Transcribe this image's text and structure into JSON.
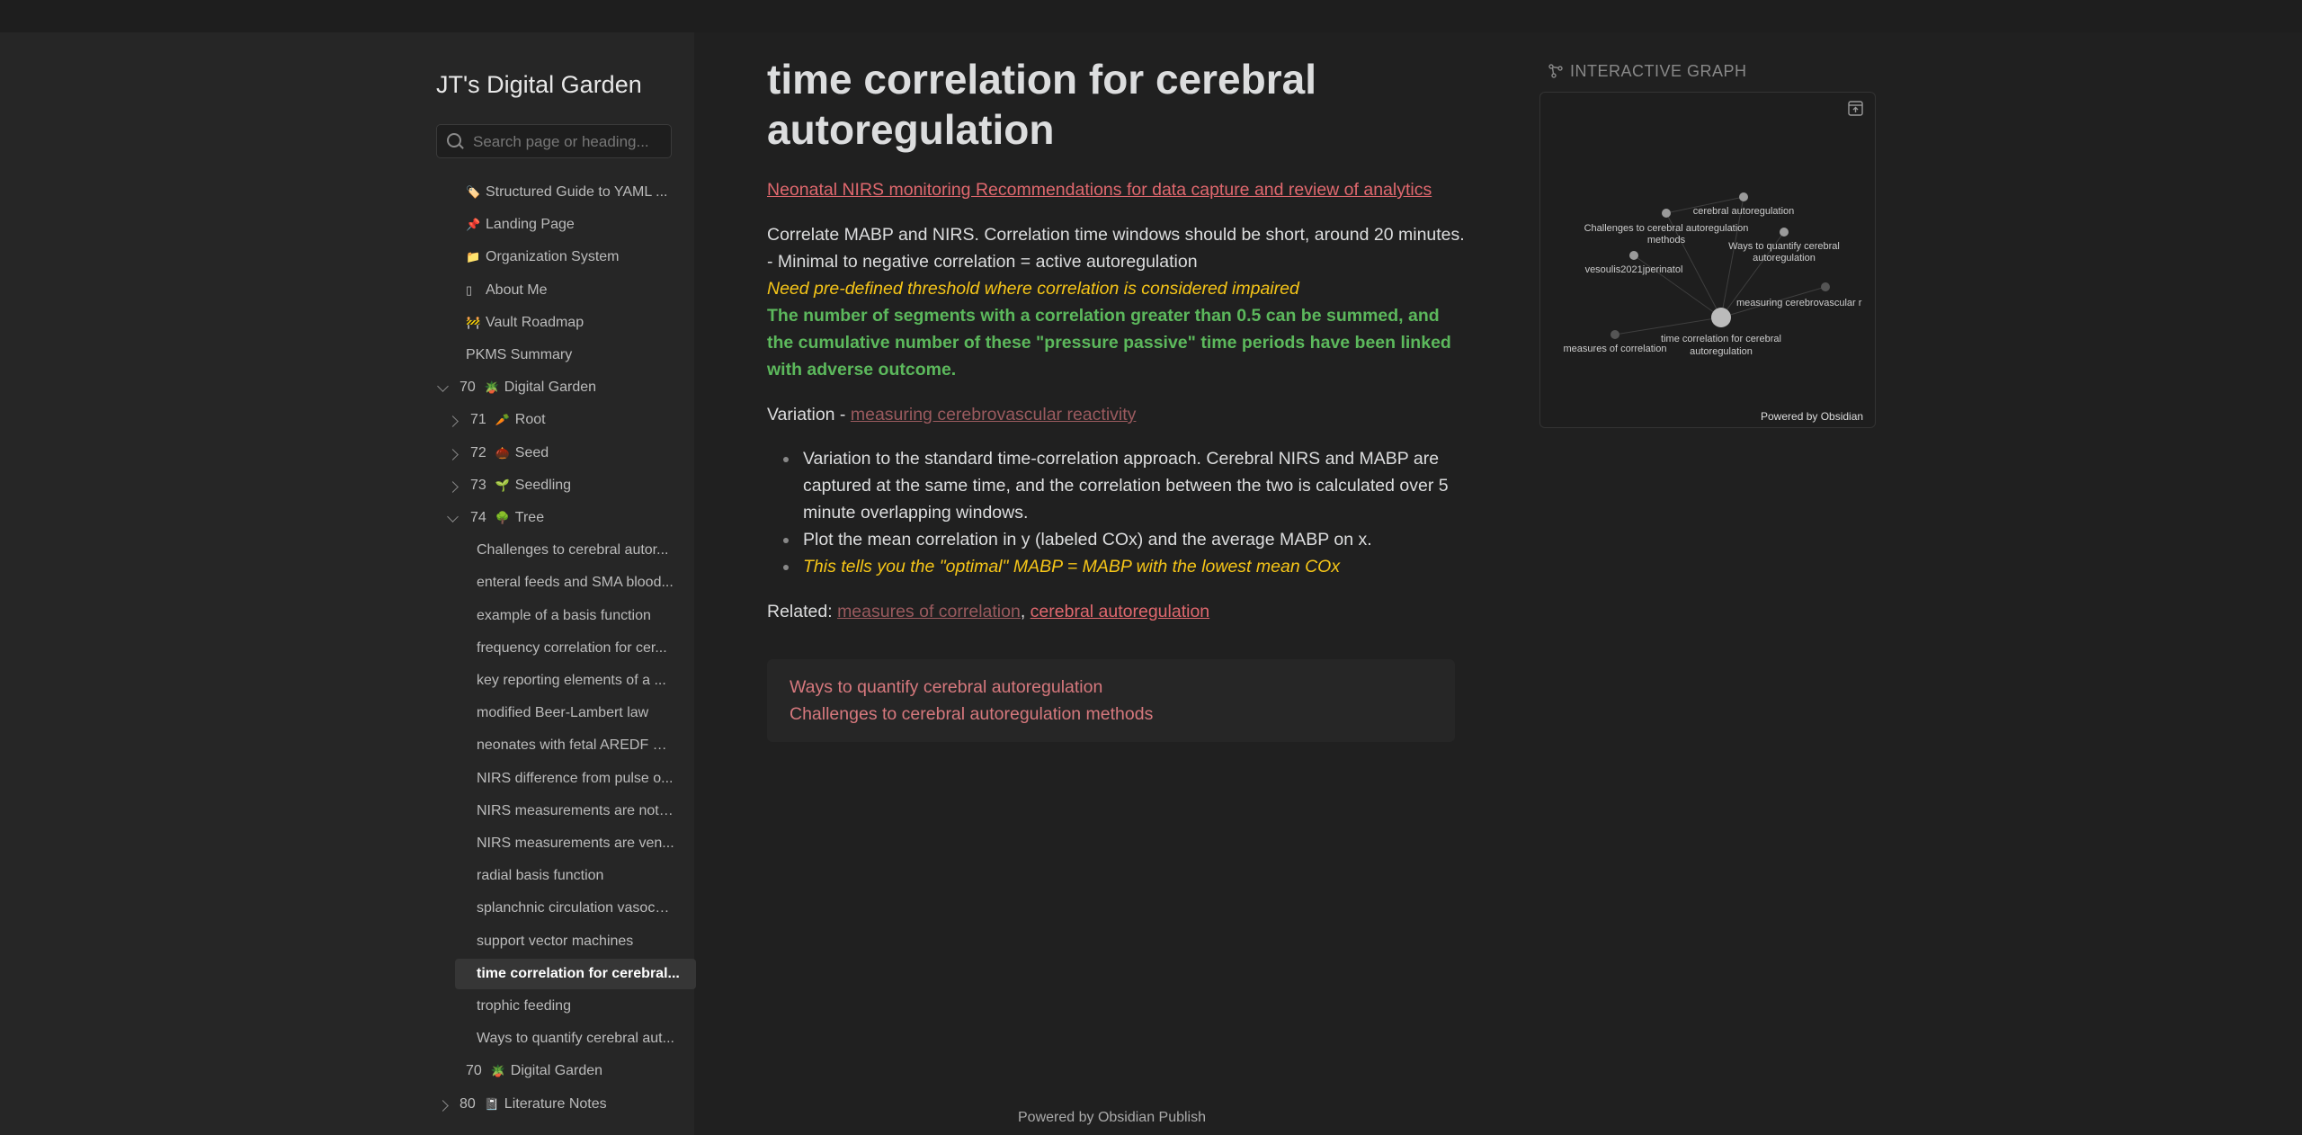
{
  "site": {
    "title": "JT's Digital Garden",
    "search_placeholder": "Search page or heading..."
  },
  "sidebar": {
    "top_items": [
      {
        "icon": "🏷️",
        "label": "Structured Guide to YAML ..."
      },
      {
        "icon": "📌",
        "label": "Landing Page"
      },
      {
        "icon": "📁",
        "label": "Organization System"
      },
      {
        "icon": "▯",
        "label": "About Me"
      },
      {
        "icon": "🚧",
        "label": "Vault Roadmap"
      },
      {
        "icon": "",
        "label": "PKMS Summary"
      }
    ],
    "digital_garden": {
      "num": "70",
      "icon": "🪴",
      "label": "Digital Garden"
    },
    "folders": [
      {
        "num": "71",
        "icon": "🥕",
        "label": "Root"
      },
      {
        "num": "72",
        "icon": "🌰",
        "label": "Seed"
      },
      {
        "num": "73",
        "icon": "🌱",
        "label": "Seedling"
      },
      {
        "num": "74",
        "icon": "🌳",
        "label": "Tree"
      }
    ],
    "tree_items": [
      "Challenges to cerebral autor...",
      "enteral feeds and SMA blood...",
      "example of a basis function",
      "frequency correlation for cer...",
      "key reporting elements of a ...",
      "modified Beer-Lambert law",
      "neonates with fetal AREDF ar...",
      "NIRS difference from pulse o...",
      "NIRS measurements are not ...",
      "NIRS measurements are ven...",
      "radial basis function",
      "splanchnic circulation vasoco...",
      "support vector machines",
      "time correlation for cerebral...",
      "trophic feeding",
      "Ways to quantify cerebral aut..."
    ],
    "active_index": 13,
    "garden_note": {
      "num": "70",
      "icon": "🪴",
      "label": "Digital Garden"
    },
    "literature": {
      "num": "80",
      "icon": "📓",
      "label": "Literature Notes"
    }
  },
  "page": {
    "title": "time correlation for cerebral autoregulation",
    "top_link": "Neonatal NIRS monitoring Recommendations for data capture and review of analytics",
    "p1": "Correlate MABP and NIRS. Correlation time windows should be short, around 20 minutes. - Minimal to negative correlation = active autoregulation",
    "p1_yellow": "Need pre-defined threshold where correlation is considered impaired",
    "p1_green": "The number of segments with a correlation greater than 0.5 can be summed, and the cumulative number of these \"pressure passive\" time periods have been linked with adverse outcome.",
    "variation_label": "Variation - ",
    "variation_link": "measuring cerebrovascular reactivity",
    "bullets": [
      "Variation to the standard time-correlation approach. Cerebral NIRS and MABP are captured at the same time, and the correlation between the two is calculated over 5 minute overlapping windows.",
      "Plot the mean correlation in y (labeled COx) and the average MABP on x."
    ],
    "bullet_yellow": "This tells you the \"optimal\" MABP = MABP with the lowest mean COx",
    "related_label": "Related: ",
    "related_link1": "measures of correlation",
    "related_sep": ", ",
    "related_link2": "cerebral autoregulation",
    "backlinks": [
      "Ways to quantify cerebral autoregulation",
      "Challenges to cerebral autoregulation methods"
    ],
    "footer": "Powered by Obsidian Publish"
  },
  "graph": {
    "title": "INTERACTIVE GRAPH",
    "powered": "Powered by Obsidian",
    "nodes": [
      {
        "id": "cerebral-autoregulation",
        "label1": "cerebral autoregulation",
        "label2": ""
      },
      {
        "id": "challenges",
        "label1": "Challenges to cerebral autoregulation",
        "label2": "methods"
      },
      {
        "id": "ways",
        "label1": "Ways to quantify cerebral",
        "label2": "autoregulation"
      },
      {
        "id": "vesoulis",
        "label1": "vesoulis2021jperinatol",
        "label2": ""
      },
      {
        "id": "measuring",
        "label1": "measuring cerebrovascular r",
        "label2": ""
      },
      {
        "id": "measures",
        "label1": "measures of correlation",
        "label2": ""
      },
      {
        "id": "time",
        "label1": "time correlation for cerebral",
        "label2": "autoregulation"
      }
    ]
  }
}
